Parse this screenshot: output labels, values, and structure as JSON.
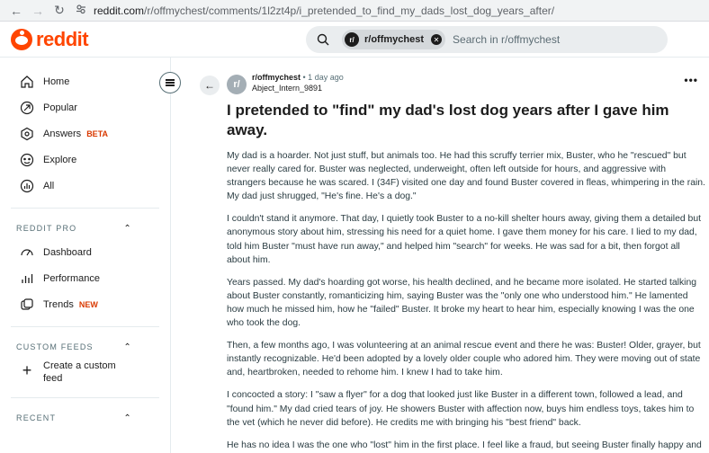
{
  "browser": {
    "url_host": "reddit.com",
    "url_path": "/r/offmychest/comments/1l2zt4p/i_pretended_to_find_my_dads_lost_dog_years_after/"
  },
  "header": {
    "logo_text": "reddit",
    "search_chip": "r/offmychest",
    "search_placeholder": "Search in r/offmychest"
  },
  "sidebar": {
    "items": [
      {
        "label": "Home",
        "icon": "home-icon"
      },
      {
        "label": "Popular",
        "icon": "popular-icon"
      },
      {
        "label": "Answers",
        "icon": "answers-icon",
        "badge": "BETA"
      },
      {
        "label": "Explore",
        "icon": "explore-icon"
      },
      {
        "label": "All",
        "icon": "all-icon"
      }
    ],
    "pro_section": "REDDIT PRO",
    "pro_items": [
      {
        "label": "Dashboard",
        "icon": "dashboard-icon"
      },
      {
        "label": "Performance",
        "icon": "performance-icon"
      },
      {
        "label": "Trends",
        "icon": "trends-icon",
        "badge": "NEW"
      }
    ],
    "feeds_section": "CUSTOM FEEDS",
    "create_feed": "Create a custom feed",
    "recent_section": "RECENT"
  },
  "post": {
    "subreddit": "r/offmychest",
    "time": "• 1 day ago",
    "author": "Abject_Intern_9891",
    "avatar_text": "r/",
    "title": "I pretended to \"find\" my dad's lost dog years after I gave him away.",
    "paragraphs": [
      "My dad is a hoarder. Not just stuff, but animals too. He had this scruffy terrier mix, Buster, who he \"rescued\" but never really cared for. Buster was neglected, underweight, often left outside for hours, and aggressive with strangers because he was scared. I (34F) visited one day and found Buster covered in fleas, whimpering in the rain. My dad just shrugged, \"He's fine. He's a dog.\"",
      "I couldn't stand it anymore. That day, I quietly took Buster to a no-kill shelter hours away, giving them a detailed but anonymous story about him, stressing his need for a quiet home. I gave them money for his care. I lied to my dad, told him Buster \"must have run away,\" and helped him \"search\" for weeks. He was sad for a bit, then forgot all about him.",
      "Years passed. My dad's hoarding got worse, his health declined, and he became more isolated. He started talking about Buster constantly, romanticizing him, saying Buster was the \"only one who understood him.\" He lamented how much he missed him, how he \"failed\" Buster. It broke my heart to hear him, especially knowing I was the one who took the dog.",
      "Then, a few months ago, I was volunteering at an animal rescue event and there he was: Buster! Older, grayer, but instantly recognizable. He'd been adopted by a lovely older couple who adored him. They were moving out of state and, heartbroken, needed to rehome him. I knew I had to take him.",
      "I concocted a story: I \"saw a flyer\" for a dog that looked just like Buster in a different town, followed a lead, and \"found him.\" My dad cried tears of joy. He showers Buster with affection now, buys him endless toys, takes him to the vet (which he never did before). He credits me with bringing his \"best friend\" back.",
      "He has no idea I was the one who \"lost\" him in the first place. I feel like a fraud, but seeing Buster finally happy and my dad genuinely fulfilled, I can't bring myself to confess."
    ]
  }
}
